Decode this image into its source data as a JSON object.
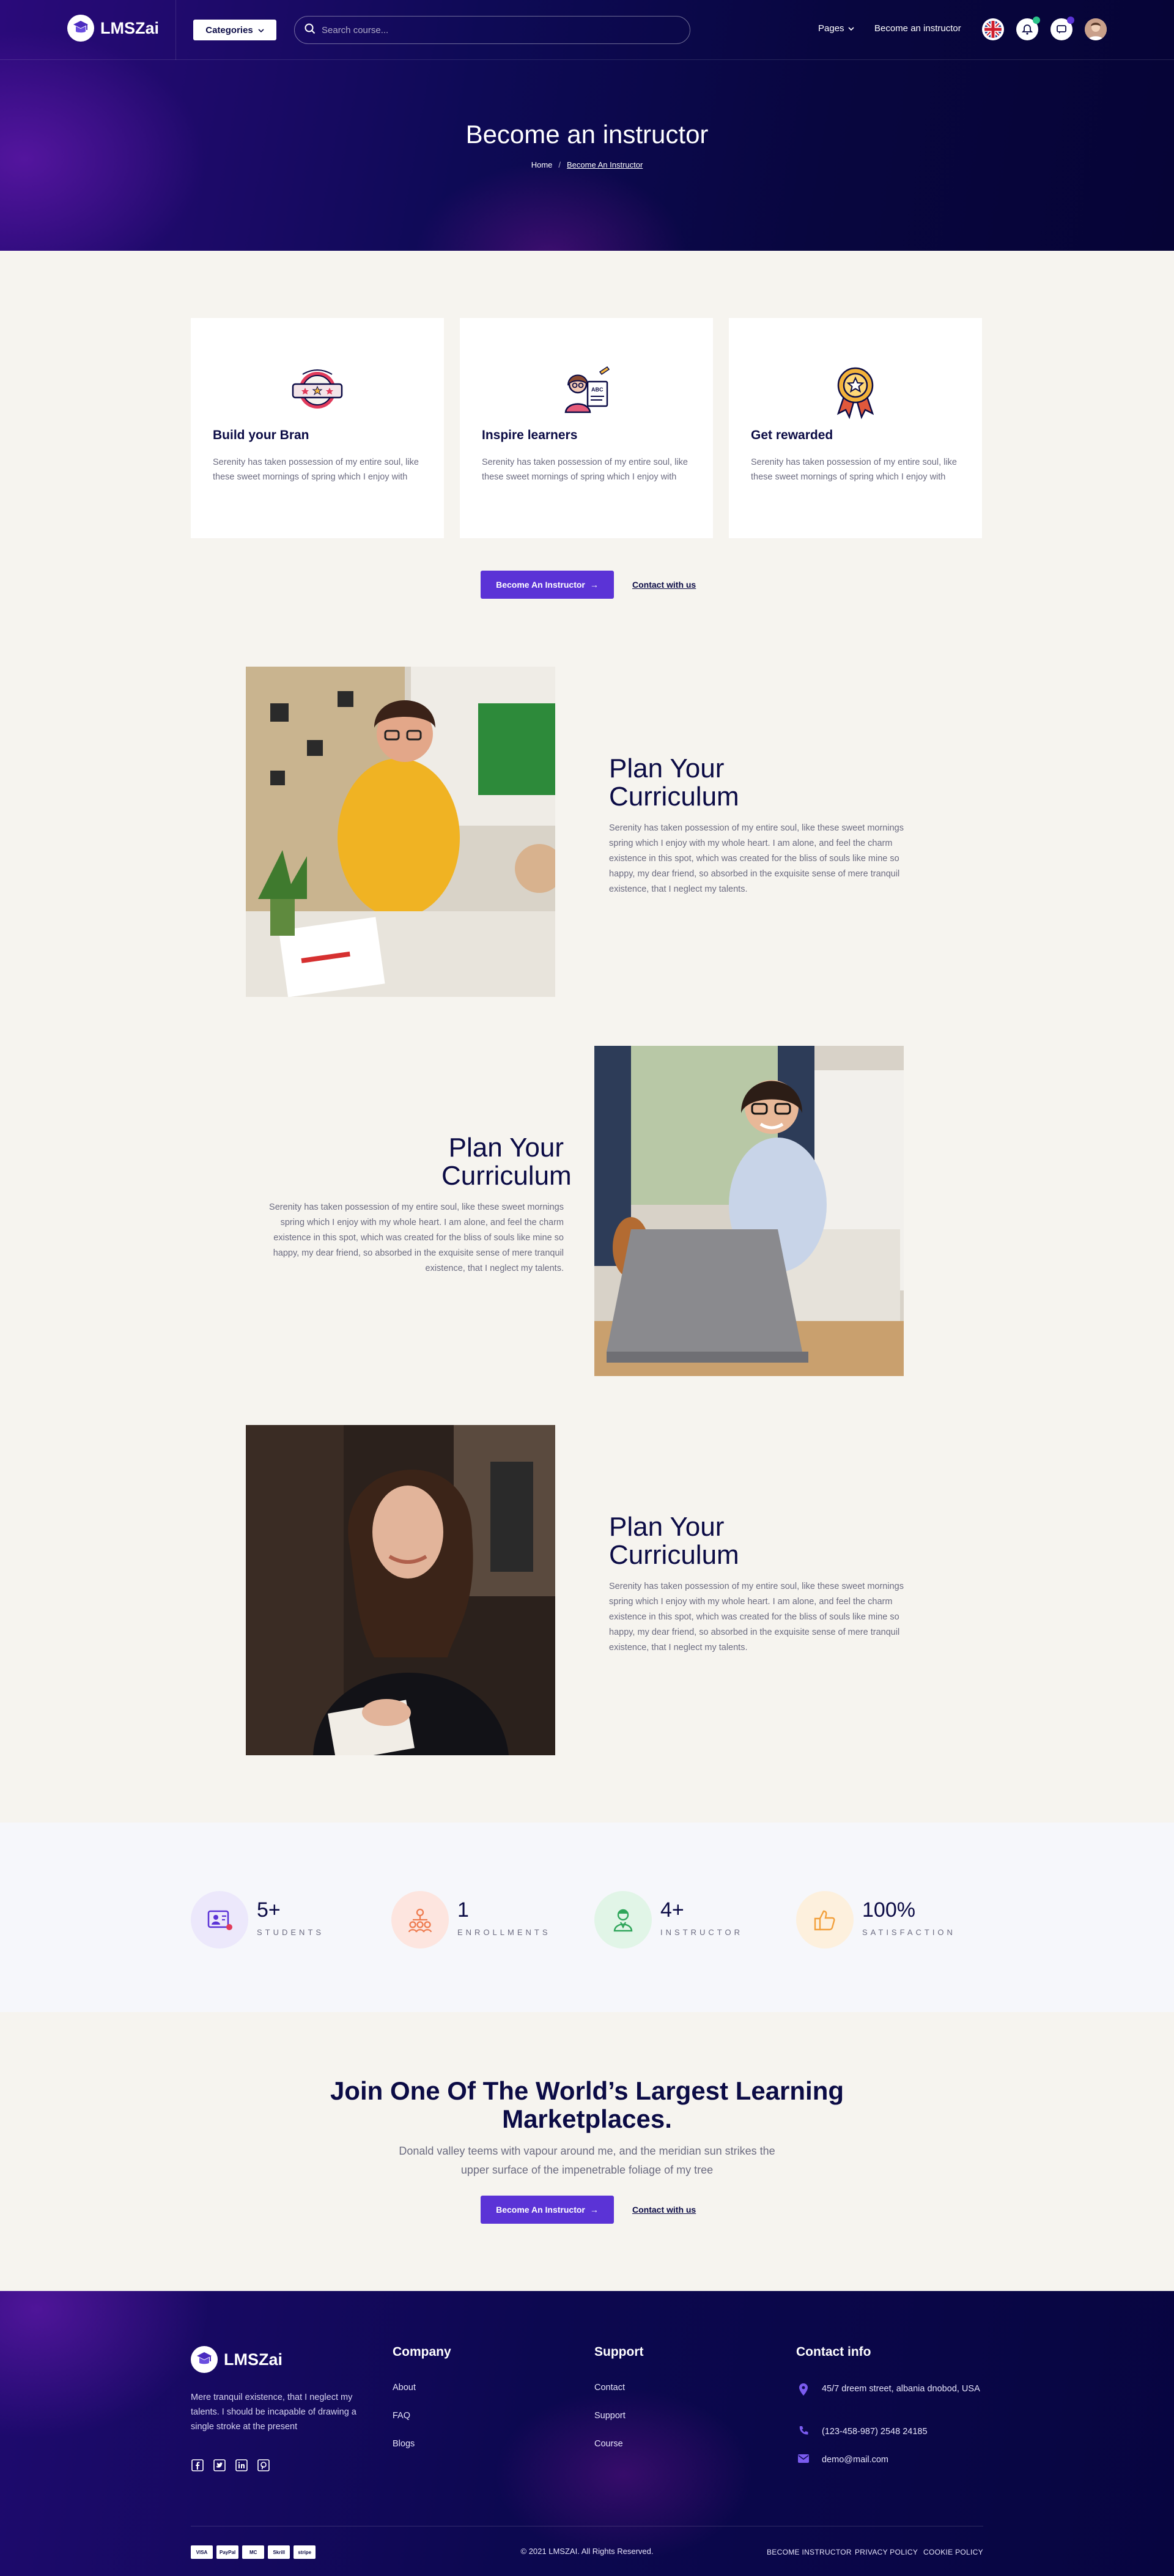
{
  "header": {
    "logo_text": "LMSZai",
    "categories_label": "Categories",
    "search_placeholder": "Search course...",
    "pages_label": "Pages",
    "become_instructor_label": "Become an instructor",
    "icons": [
      "uk-flag-icon",
      "notification-icon",
      "message-icon",
      "avatar"
    ]
  },
  "hero": {
    "title": "Become an instructor",
    "breadcrumb_home": "Home",
    "breadcrumb_separator": "/",
    "breadcrumb_current": "Become An Instructor"
  },
  "features": [
    {
      "icon": "badge-stars-icon",
      "title": "Build your Bran",
      "text": "Serenity has taken possession of my entire soul, like these sweet mornings of spring which I enjoy with"
    },
    {
      "icon": "teacher-board-icon",
      "title": "Inspire learners",
      "text": "Serenity has taken possession of my entire soul, like these sweet mornings of spring which I enjoy with"
    },
    {
      "icon": "medal-icon",
      "title": "Get rewarded",
      "text": "Serenity has taken possession of my entire soul, like these sweet mornings of spring which I enjoy with"
    }
  ],
  "actions": {
    "become_instructor": "Become An Instructor",
    "arrow": "→",
    "contact": "Contact with us"
  },
  "curriculum": [
    {
      "title_line1": "Plan Your",
      "title_line2": "Curriculum",
      "text": "Serenity has taken possession of my entire soul, like these sweet mornings spring which I enjoy with my whole heart. I am alone, and feel the charm existence in this spot, which was created for the bliss of souls like mine so happy, my dear friend, so absorbed in the exquisite sense of mere tranquil existence, that I neglect my talents."
    },
    {
      "title_line1": "Plan Your",
      "title_line2": "Curriculum",
      "text": "Serenity has taken possession of my entire soul, like these sweet mornings spring which I enjoy with my whole heart. I am alone, and feel the charm existence in this spot, which was created for the bliss of souls like mine so happy, my dear friend, so absorbed in the exquisite sense of mere tranquil existence, that I neglect my talents."
    },
    {
      "title_line1": "Plan Your",
      "title_line2": "Curriculum",
      "text": "Serenity has taken possession of my entire soul, like these sweet mornings spring which I enjoy with my whole heart. I am alone, and feel the charm existence in this spot, which was created for the bliss of souls like mine so happy, my dear friend, so absorbed in the exquisite sense of mere tranquil existence, that I neglect my talents."
    }
  ],
  "stats": [
    {
      "value": "5+",
      "label": "STUDENTS",
      "icon": "student-icon",
      "color": "#ece8fb"
    },
    {
      "value": "1",
      "label": "ENROLLMENTS",
      "icon": "enrollment-icon",
      "color": "#fde5df"
    },
    {
      "value": "4+",
      "label": "INSTRUCTOR",
      "icon": "instructor-icon",
      "color": "#e1f5e7"
    },
    {
      "value": "100%",
      "label": "SATISFACTION",
      "icon": "thumbs-up-icon",
      "color": "#fdf0dd"
    }
  ],
  "cta": {
    "title_line1": "Join One Of The World’s Largest Learning",
    "title_line2": "Marketplaces.",
    "subtitle": "Donald valley teems with vapour around me, and the meridian sun strikes the upper surface of the impenetrable foliage of my tree"
  },
  "footer": {
    "logo_text": "LMSZai",
    "about": "Mere tranquil existence, that I neglect my talents. I should be incapable of drawing a single stroke at the present",
    "company_title": "Company",
    "company_links": [
      "About",
      "FAQ",
      "Blogs"
    ],
    "support_title": "Support",
    "support_links": [
      "Contact",
      "Support",
      "Course"
    ],
    "contact_title": "Contact info",
    "address": "45/7 dreem street, albania dnobod, USA",
    "phone": "(123-458-987) 2548 24185",
    "email": "demo@mail.com",
    "payments": [
      "VISA",
      "PayPal",
      "MC",
      "Skrill",
      "stripe"
    ],
    "copyright": "© 2021 LMSZAI. All Rights Reserved.",
    "legal_links": [
      "BECOME INSTRUCTOR",
      "PRIVACY POLICY",
      "COOKIE POLICY"
    ]
  },
  "colors": {
    "primary": "#5b33d6",
    "navy": "#0b0b45",
    "hero_dark": "#08063f"
  }
}
